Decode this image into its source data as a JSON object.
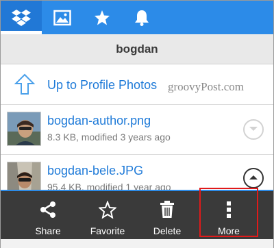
{
  "tabs": [
    {
      "name": "dropbox-tab",
      "icon": "dropbox-icon",
      "active": true
    },
    {
      "name": "photos-tab",
      "icon": "image-icon",
      "active": false
    },
    {
      "name": "favorites-tab",
      "icon": "star-icon",
      "active": false
    },
    {
      "name": "notifications-tab",
      "icon": "bell-icon",
      "active": false
    }
  ],
  "folder": {
    "title": "bogdan"
  },
  "up": {
    "label": "Up to Profile Photos",
    "icon": "up-arrow-icon"
  },
  "watermark": "groovyPost.com",
  "files": [
    {
      "name": "bogdan-author.png",
      "meta": "8.3 KB, modified 3 years ago",
      "state": "collapsed"
    },
    {
      "name": "bogdan-bele.JPG",
      "meta": "95.4 KB, modified 1 year ago",
      "state": "expanded"
    }
  ],
  "actions": [
    {
      "label": "Share",
      "icon": "share-icon"
    },
    {
      "label": "Favorite",
      "icon": "star-outline-icon"
    },
    {
      "label": "Delete",
      "icon": "trash-icon"
    },
    {
      "label": "More",
      "icon": "more-vertical-icon"
    }
  ],
  "colors": {
    "accent": "#2c8be8",
    "link": "#1e7ad8",
    "actionbar": "#3a3a3a",
    "highlight": "#e11a1a"
  }
}
